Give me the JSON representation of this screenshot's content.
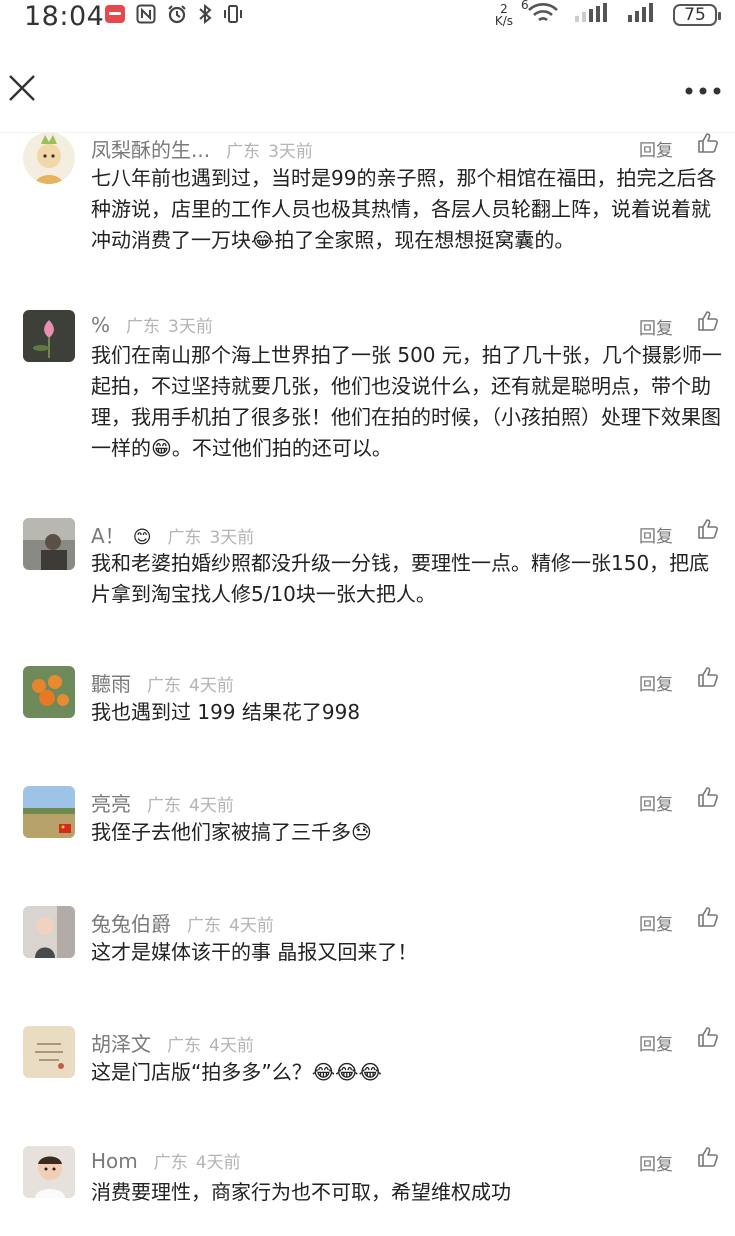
{
  "status_bar": {
    "time": "18:04",
    "net_speed_value": "2",
    "net_speed_unit": "K/s",
    "signal_label": "6",
    "battery": "75"
  },
  "comments": [
    {
      "nickname": "凤梨酥的生...",
      "location": "广东",
      "time": "3天前",
      "reply": "回复",
      "text": "七八年前也遇到过，当时是99的亲子照，那个相馆在福田，拍完之后各种游说，店里的工作人员也极其热情，各层人员轮翻上阵，说着说着就冲动消费了一万块😂拍了全家照，现在想想挺窝囊的。"
    },
    {
      "nickname": "%",
      "location": "广东",
      "time": "3天前",
      "reply": "回复",
      "text": "我们在南山那个海上世界拍了一张 500 元，拍了几十张，几个摄影师一起拍，不过坚持就要几张，他们也没说什么，还有就是聪明点，带个助理，我用手机拍了很多张！他们在拍的时候，（小孩拍照）处理下效果图一样的😁。不过他们拍的还可以。"
    },
    {
      "nickname": "A！",
      "nickname_emoji": "😊",
      "location": "广东",
      "time": "3天前",
      "reply": "回复",
      "text": "我和老婆拍婚纱照都没升级一分钱，要理性一点。精修一张150，把底片拿到淘宝找人修5/10块一张大把人。"
    },
    {
      "nickname": "聽雨",
      "location": "广东",
      "time": "4天前",
      "reply": "回复",
      "text": "我也遇到过 199  结果花了998"
    },
    {
      "nickname": "亮亮",
      "location": "广东",
      "time": "4天前",
      "reply": "回复",
      "text": "我侄子去他们家被搞了三千多😓"
    },
    {
      "nickname": "兔兔伯爵",
      "location": "广东",
      "time": "4天前",
      "reply": "回复",
      "text": "这才是媒体该干的事 晶报又回来了！"
    },
    {
      "nickname": "胡泽文",
      "location": "广东",
      "time": "4天前",
      "reply": "回复",
      "text": "这是门店版“拍多多”么？😂😂😂"
    },
    {
      "nickname": "Hom",
      "location": "广东",
      "time": "4天前",
      "reply": "回复",
      "text": "消费要理性，商家行为也不可取，希望维权成功"
    }
  ],
  "colors": {
    "nickname": "#7a7a7a",
    "meta": "#b4b4b4",
    "text": "#222222"
  }
}
